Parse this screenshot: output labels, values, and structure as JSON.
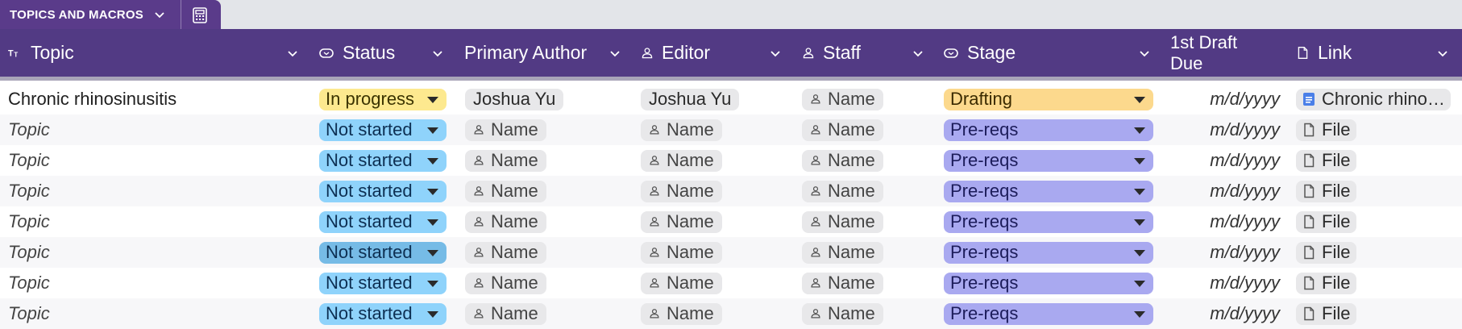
{
  "tab": {
    "label": "TOPICS AND MACROS"
  },
  "columns": [
    {
      "key": "topic",
      "label": "Topic",
      "icon": "text-type-icon"
    },
    {
      "key": "status",
      "label": "Status",
      "icon": "dropdown-chip-icon"
    },
    {
      "key": "primary_author",
      "label": "Primary Author",
      "icon": ""
    },
    {
      "key": "editor",
      "label": "Editor",
      "icon": "person-icon"
    },
    {
      "key": "staff",
      "label": "Staff",
      "icon": "person-icon"
    },
    {
      "key": "stage",
      "label": "Stage",
      "icon": "dropdown-chip-icon"
    },
    {
      "key": "first_draft_due",
      "label": "1st Draft Due",
      "icon": ""
    },
    {
      "key": "link",
      "label": "Link",
      "icon": "file-icon"
    }
  ],
  "rows": [
    {
      "topic": "Chronic rhinosinusitis",
      "topic_placeholder": false,
      "status": "In progress",
      "primary_author": "Joshua Yu",
      "author_placeholder": false,
      "editor": "Joshua Yu",
      "editor_placeholder": false,
      "staff": "Name",
      "stage": "Drafting",
      "due": "m/d/yyyy",
      "link": "Chronic rhino…",
      "link_is_doc": true
    },
    {
      "topic": "Topic",
      "topic_placeholder": true,
      "status": "Not started",
      "primary_author": "Name",
      "author_placeholder": true,
      "editor": "Name",
      "editor_placeholder": true,
      "staff": "Name",
      "stage": "Pre-reqs",
      "due": "m/d/yyyy",
      "link": "File",
      "link_is_doc": false
    },
    {
      "topic": "Topic",
      "topic_placeholder": true,
      "status": "Not started",
      "primary_author": "Name",
      "author_placeholder": true,
      "editor": "Name",
      "editor_placeholder": true,
      "staff": "Name",
      "stage": "Pre-reqs",
      "due": "m/d/yyyy",
      "link": "File",
      "link_is_doc": false
    },
    {
      "topic": "Topic",
      "topic_placeholder": true,
      "status": "Not started",
      "primary_author": "Name",
      "author_placeholder": true,
      "editor": "Name",
      "editor_placeholder": true,
      "staff": "Name",
      "stage": "Pre-reqs",
      "due": "m/d/yyyy",
      "link": "File",
      "link_is_doc": false
    },
    {
      "topic": "Topic",
      "topic_placeholder": true,
      "status": "Not started",
      "primary_author": "Name",
      "author_placeholder": true,
      "editor": "Name",
      "editor_placeholder": true,
      "staff": "Name",
      "stage": "Pre-reqs",
      "due": "m/d/yyyy",
      "link": "File",
      "link_is_doc": false
    },
    {
      "topic": "Topic",
      "topic_placeholder": true,
      "status": "Not started",
      "primary_author": "Name",
      "author_placeholder": true,
      "editor": "Name",
      "editor_placeholder": true,
      "staff": "Name",
      "stage": "Pre-reqs",
      "due": "m/d/yyyy",
      "link": "File",
      "link_is_doc": false,
      "status_hover": true
    },
    {
      "topic": "Topic",
      "topic_placeholder": true,
      "status": "Not started",
      "primary_author": "Name",
      "author_placeholder": true,
      "editor": "Name",
      "editor_placeholder": true,
      "staff": "Name",
      "stage": "Pre-reqs",
      "due": "m/d/yyyy",
      "link": "File",
      "link_is_doc": false
    },
    {
      "topic": "Topic",
      "topic_placeholder": true,
      "status": "Not started",
      "primary_author": "Name",
      "author_placeholder": true,
      "editor": "Name",
      "editor_placeholder": true,
      "staff": "Name",
      "stage": "Pre-reqs",
      "due": "m/d/yyyy",
      "link": "File",
      "link_is_doc": false
    }
  ],
  "colors": {
    "header_bg": "#523a84",
    "tab_bg": "#5a3b8a",
    "status_in_progress": "#fde98f",
    "status_not_started": "#8fd3fb",
    "status_not_started_hover": "#76bbe6",
    "stage_drafting": "#fcd98d",
    "stage_prereqs": "#a9a9f0",
    "doc_icon": "#4a7fe8"
  }
}
